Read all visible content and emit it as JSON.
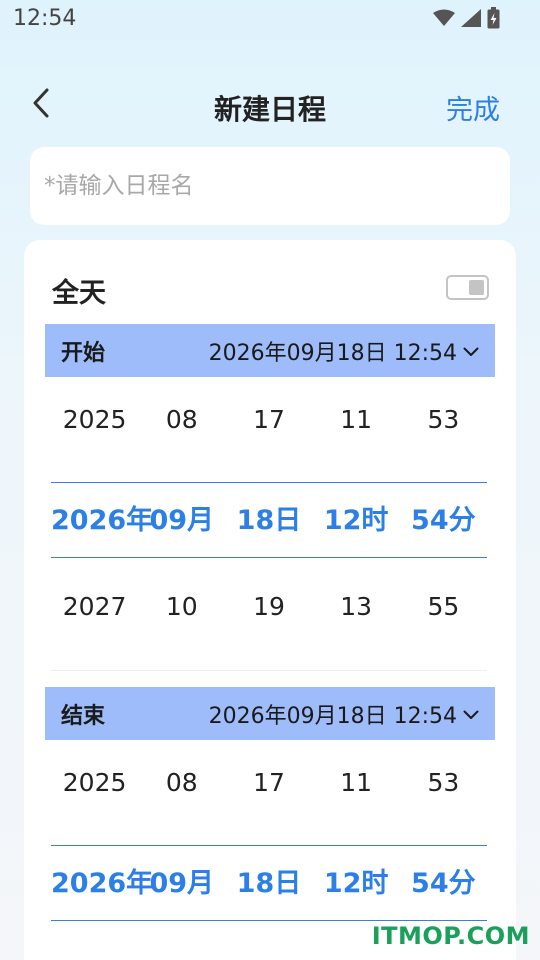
{
  "status_bar": {
    "time": "12:54"
  },
  "header": {
    "title": "新建日程",
    "done_label": "完成"
  },
  "name_field": {
    "placeholder": "*请输入日程名",
    "value": ""
  },
  "all_day": {
    "label": "全天",
    "enabled": false
  },
  "start": {
    "label": "开始",
    "value": "2026年09月18日 12:54",
    "above": [
      "2025",
      "08",
      "17",
      "11",
      "53"
    ],
    "selected": [
      "2026年",
      "09月",
      "18日",
      "12时",
      "54分"
    ],
    "below": [
      "2027",
      "10",
      "19",
      "13",
      "55"
    ]
  },
  "end": {
    "label": "结束",
    "value": "2026年09月18日 12:54",
    "above": [
      "2025",
      "08",
      "17",
      "11",
      "53"
    ],
    "selected": [
      "2026年",
      "09月",
      "18日",
      "12时",
      "54分"
    ]
  },
  "watermark": "ITMOP.COM",
  "colors": {
    "accent": "#2b7fe6",
    "section_bar": "#9dbcf9",
    "watermark": "#1aa05a"
  }
}
